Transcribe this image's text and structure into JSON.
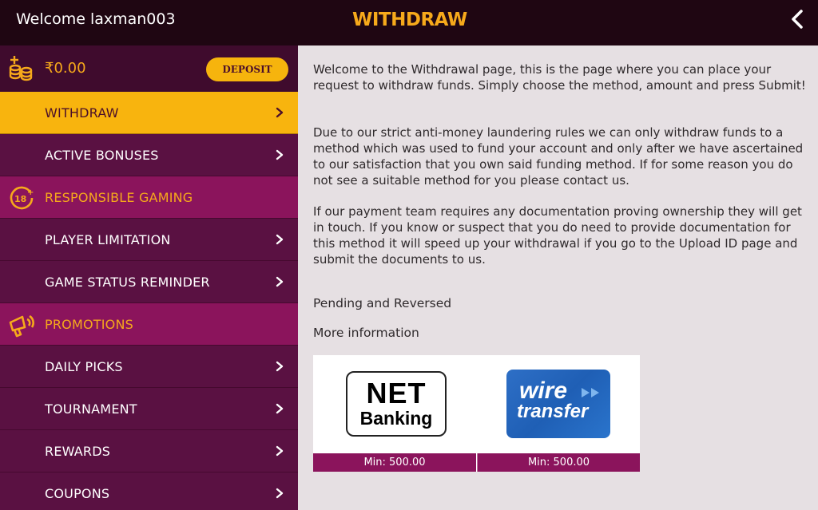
{
  "header": {
    "welcome": "Welcome laxman003",
    "title": "WITHDRAW",
    "back_icon": "chevron-left-icon"
  },
  "account": {
    "balance": "₹0.00",
    "balance_icon": "coins-icon",
    "deposit_label": "DEPOSIT"
  },
  "sidebar": {
    "items": [
      {
        "label": "WITHDRAW",
        "type": "sub",
        "active": true
      },
      {
        "label": "ACTIVE BONUSES",
        "type": "sub"
      },
      {
        "label": "RESPONSIBLE GAMING",
        "type": "section",
        "icon": "age-18-plus-icon"
      },
      {
        "label": "PLAYER LIMITATION",
        "type": "sub"
      },
      {
        "label": "GAME STATUS REMINDER",
        "type": "sub"
      },
      {
        "label": "PROMOTIONS",
        "type": "section",
        "icon": "megaphone-icon"
      },
      {
        "label": "DAILY PICKS",
        "type": "sub"
      },
      {
        "label": "TOURNAMENT",
        "type": "sub"
      },
      {
        "label": "REWARDS",
        "type": "sub"
      },
      {
        "label": "COUPONS",
        "type": "sub"
      }
    ]
  },
  "content": {
    "paragraphs": [
      "Welcome to the Withdrawal page, this is the page where you can place your request to withdraw funds. Simply choose the method, amount and press Submit!",
      "Due to our strict anti-money laundering rules we can only withdraw funds to a method which was used to fund your account and only after we have ascertained to our satisfaction that you own said funding method. If for some reason you do not see a suitable method for you please contact us.",
      "If our payment team requires any documentation proving ownership they will get in touch. If you know or suspect that you do need to provide documentation for this method it will speed up your withdrawal if you go to the Upload ID page and submit the documents to us."
    ],
    "links": [
      "Pending and Reversed",
      "More information"
    ],
    "methods": [
      {
        "name": "NET Banking",
        "logo_line1": "NET",
        "logo_line2": "Banking",
        "min": "Min: 500.00"
      },
      {
        "name": "wire transfer",
        "logo_line1": "wire",
        "logo_line2": "transfer",
        "min": "Min: 500.00",
        "color": "#2a6cc4"
      }
    ]
  },
  "colors": {
    "accent": "#f6a91b",
    "topbar": "#1f0612",
    "sidebar": "#5a1142",
    "section": "#8b145c",
    "active": "#f8b40e"
  }
}
